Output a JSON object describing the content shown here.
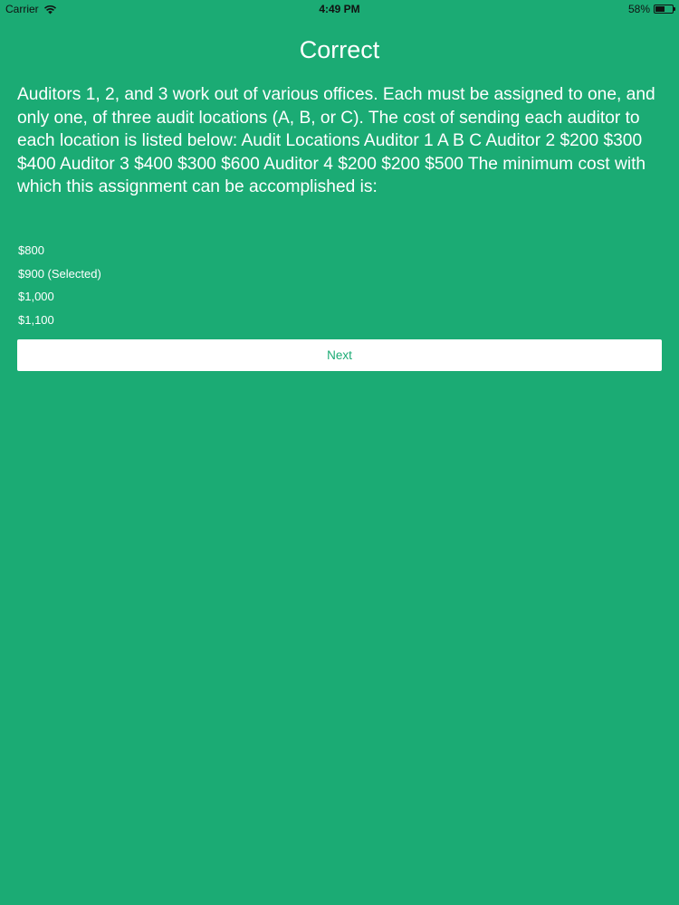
{
  "status_bar": {
    "carrier": "Carrier",
    "time": "4:49 PM",
    "battery_text": "58%",
    "battery_level": 0.58,
    "icons": [
      "wifi-icon",
      "battery-icon"
    ]
  },
  "screen": {
    "title": "Correct",
    "question": "Auditors 1, 2, and 3 work out of various offices. Each must be assigned to one, and only one, of three audit locations (A, B, or C). The cost of sending each auditor to each location is listed below: Audit Locations Auditor 1 A B C Auditor 2 $200 $300 $400 Auditor 3 $400 $300 $600 Auditor 4 $200 $200 $500 The minimum cost with which this assignment can be accomplished is:",
    "answers": [
      {
        "label": "$800"
      },
      {
        "label": "$900 (Selected)"
      },
      {
        "label": "$1,000"
      },
      {
        "label": "$1,100"
      }
    ],
    "next_label": "Next"
  },
  "colors": {
    "background": "#1bab74",
    "text": "#ffffff",
    "button_background": "#ffffff",
    "button_text": "#1bab74"
  }
}
